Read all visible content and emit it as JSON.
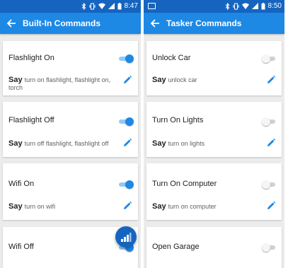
{
  "left_screen": {
    "status_time": "8:47",
    "title": "Built-In Commands",
    "say_label": "Say",
    "cards": [
      {
        "title": "Flashlight On",
        "toggle": "on",
        "phrase": "turn on flashlight, flashlight on, torch"
      },
      {
        "title": "Flashlight Off",
        "toggle": "on",
        "phrase": "turn off flashlight, flashlight off"
      },
      {
        "title": "Wifi On",
        "toggle": "on",
        "phrase": "turn on wifi"
      },
      {
        "title": "Wifi Off",
        "toggle": "on",
        "phrase": ""
      }
    ],
    "fab_icon": "signal-icon"
  },
  "right_screen": {
    "status_time": "8:50",
    "title": "Tasker Commands",
    "say_label": "Say",
    "cards": [
      {
        "title": "Unlock Car",
        "toggle": "off",
        "phrase": "unlock car"
      },
      {
        "title": "Turn On Lights",
        "toggle": "off",
        "phrase": "turn on lights"
      },
      {
        "title": "Turn On Computer",
        "toggle": "off",
        "phrase": "turn on computer"
      },
      {
        "title": "Open Garage",
        "toggle": "off",
        "phrase": ""
      }
    ]
  },
  "colors": {
    "status_bar": "#1565c0",
    "app_bar": "#1e88e5",
    "accent": "#1e88e5",
    "background": "#ececec"
  },
  "icons": {
    "back": "arrow-back-icon",
    "edit": "pencil-icon",
    "status": [
      "bluetooth-icon",
      "vibrate-icon",
      "wifi-icon",
      "cell-signal-icon",
      "battery-icon"
    ]
  }
}
